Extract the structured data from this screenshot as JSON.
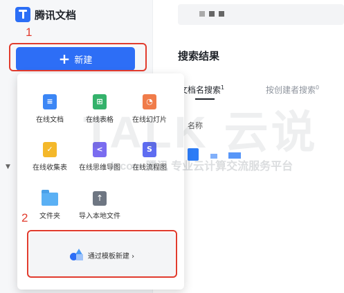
{
  "brand": {
    "name": "腾讯文档",
    "color": "#2b6ef6"
  },
  "sidebar": {
    "new_label": "新建"
  },
  "annotations": {
    "step1": "1",
    "step2": "2",
    "color": "#e13b2d"
  },
  "main": {
    "title": "搜索结果",
    "tabs": [
      {
        "label": "文档名搜索",
        "count": "1",
        "active": true
      },
      {
        "label": "按创建者搜索",
        "count": "0",
        "active": false
      }
    ],
    "column_name": "名称"
  },
  "new_menu": {
    "items": [
      {
        "label": "在线文档",
        "icon": "doc-icon",
        "color": "#3b86f5",
        "mark": "≡"
      },
      {
        "label": "在线表格",
        "icon": "sheet-icon",
        "color": "#34b26b",
        "mark": "⊞"
      },
      {
        "label": "在线幻灯片",
        "icon": "slides-icon",
        "color": "#f07c4a",
        "mark": "◔"
      },
      {
        "label": "在线收集表",
        "icon": "form-icon",
        "color": "#f4b82a",
        "mark": "✓"
      },
      {
        "label": "在线思维导图",
        "icon": "mindmap-icon",
        "color": "#7a6cf0",
        "mark": "<"
      },
      {
        "label": "在线流程图",
        "icon": "flowchart-icon",
        "color": "#5e6cf1",
        "mark": "S"
      },
      {
        "label": "文件夹",
        "icon": "folder-icon",
        "color": "#5ab0f4"
      },
      {
        "label": "导入本地文件",
        "icon": "upload-icon",
        "color": "#6e7682",
        "mark": "↑"
      }
    ],
    "template_label": "通过模板新建 ›"
  },
  "watermark": {
    "big": "TALK 云说",
    "small": "k.com 腾讯 专业云计算交流服务平台"
  }
}
